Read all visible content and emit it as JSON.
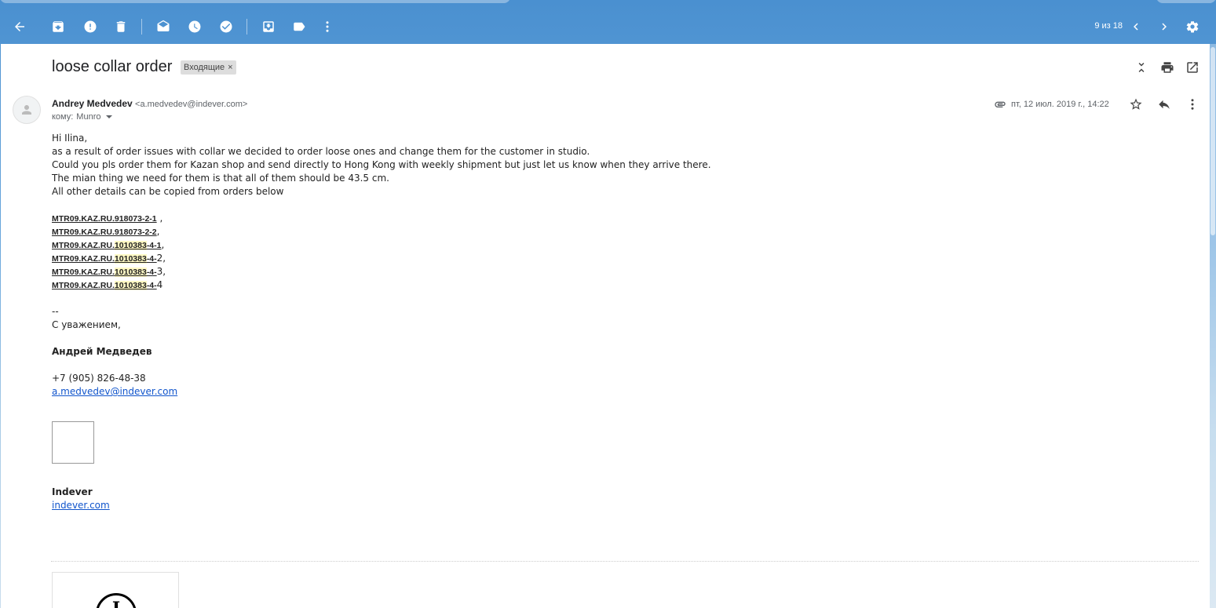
{
  "toolbar": {
    "pager": "9 из 18"
  },
  "message": {
    "subject": "loose collar order",
    "label": "Входящие",
    "sender_name": "Andrey Medvedev",
    "sender_email": "<a.medvedev@indever.com>",
    "to_prefix": "кому:",
    "to_name": "Munro",
    "date": "пт, 12 июл. 2019 г., 14:22"
  },
  "body": {
    "greeting": "Hi Ilina,",
    "line1": "as a result of order issues with collar we decided to order loose ones and change them for the customer in studio.",
    "line2": "Could you pls order them for Kazan shop and send directly to Hong Kong with weekly shipment but just let us know when they arrive there.",
    "line3": "The mian thing we need for them is that all of them should be 43.5 cm.",
    "line4": "All other details can be copied from orders below",
    "orders": [
      {
        "prefix": "MTR09.KAZ.RU.918073-2-1",
        "hl": "",
        "suffix": "",
        "tail": " ,"
      },
      {
        "prefix": "MTR09.KAZ.RU.918073-2-2",
        "hl": "",
        "suffix": "",
        "tail": ","
      },
      {
        "prefix": "MTR09.KAZ.RU.",
        "hl": "1010383",
        "suffix": "-4-1",
        "tail": ","
      },
      {
        "prefix": "MTR09.KAZ.RU.",
        "hl": "1010383",
        "suffix": "-4-",
        "tail": "2,"
      },
      {
        "prefix": "MTR09.KAZ.RU.",
        "hl": "1010383",
        "suffix": "-4-",
        "tail": "3,"
      },
      {
        "prefix": "MTR09.KAZ.RU.",
        "hl": "1010383",
        "suffix": "-4-",
        "tail": "4"
      }
    ],
    "sig_dash": "--",
    "regards": "С уважением,",
    "sig_name": "Андрей Медведев",
    "phone": "+7 (905) 826-48-38",
    "email_link": "a.medvedev@indever.com",
    "company": "Indever",
    "company_link": "indever.com"
  },
  "colors": {
    "link": "#1155cc",
    "highlight": "#fff9c4",
    "toolbar_bg": "#4a90d0"
  }
}
